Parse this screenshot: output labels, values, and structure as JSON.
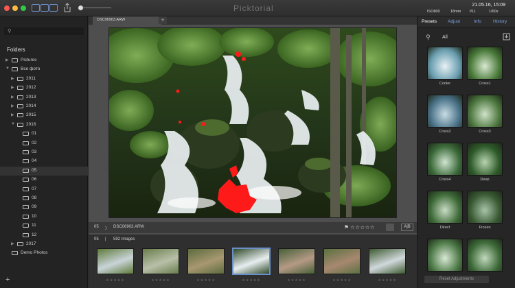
{
  "app": {
    "title": "Picktorial"
  },
  "exif": {
    "iso": "ISO800",
    "focal": "18mm",
    "aperture": "f/11",
    "shutter": "1/60s",
    "datetime": "21.05.16, 15:09"
  },
  "sidebar": {
    "folders_heading": "Folders",
    "tree": [
      {
        "label": "Pictures",
        "indent": 1,
        "arrow": "▶"
      },
      {
        "label": "Все фото",
        "indent": 1,
        "arrow": "▼"
      },
      {
        "label": "2011",
        "indent": 2,
        "arrow": "▶"
      },
      {
        "label": "2012",
        "indent": 2,
        "arrow": "▶"
      },
      {
        "label": "2013",
        "indent": 2,
        "arrow": "▶"
      },
      {
        "label": "2014",
        "indent": 2,
        "arrow": "▶"
      },
      {
        "label": "2015",
        "indent": 2,
        "arrow": "▶"
      },
      {
        "label": "2016",
        "indent": 2,
        "arrow": "▼"
      },
      {
        "label": "01",
        "indent": 3,
        "arrow": ""
      },
      {
        "label": "02",
        "indent": 3,
        "arrow": ""
      },
      {
        "label": "03",
        "indent": 3,
        "arrow": ""
      },
      {
        "label": "04",
        "indent": 3,
        "arrow": ""
      },
      {
        "label": "05",
        "indent": 3,
        "arrow": "",
        "selected": true
      },
      {
        "label": "06",
        "indent": 3,
        "arrow": ""
      },
      {
        "label": "07",
        "indent": 3,
        "arrow": ""
      },
      {
        "label": "08",
        "indent": 3,
        "arrow": ""
      },
      {
        "label": "09",
        "indent": 3,
        "arrow": ""
      },
      {
        "label": "10",
        "indent": 3,
        "arrow": ""
      },
      {
        "label": "11",
        "indent": 3,
        "arrow": ""
      },
      {
        "label": "12",
        "indent": 3,
        "arrow": ""
      },
      {
        "label": "2017",
        "indent": 2,
        "arrow": "▶"
      },
      {
        "label": "Demo Photos",
        "indent": 1,
        "arrow": ""
      }
    ],
    "add_label": "+"
  },
  "viewer": {
    "tab_label": "DSC06903.ARW",
    "tab_add": "+",
    "folder_num": "05",
    "breadcrumb_sep": "〉",
    "filename": "DSC06903.ARW",
    "rating": "☆☆☆☆☆",
    "ab_label": "A|B"
  },
  "filmstrip": {
    "folder": "05",
    "sep": "|",
    "count": "592 Images",
    "thumbs": [
      {
        "stars": "★★★★★"
      },
      {
        "stars": "★★★★★"
      },
      {
        "stars": "★★★★★"
      },
      {
        "stars": "★★★★★",
        "selected": true
      },
      {
        "stars": "★★★★★"
      },
      {
        "stars": "★★★★★"
      },
      {
        "stars": "★★★★★"
      }
    ]
  },
  "right": {
    "tabs": [
      "Presets",
      "Adjust",
      "Info",
      "History"
    ],
    "active_tab": "Presets",
    "preset_filter": "All",
    "presets": [
      "Cooler",
      "Cross1",
      "Cross2",
      "Cross3",
      "Cross4",
      "Deep",
      "Direct",
      "Frozen",
      "",
      ""
    ],
    "reset_label": "Reset Adjustments"
  },
  "colors": {
    "accent": "#6a8ec8",
    "clipping": "#ff1a1a"
  }
}
